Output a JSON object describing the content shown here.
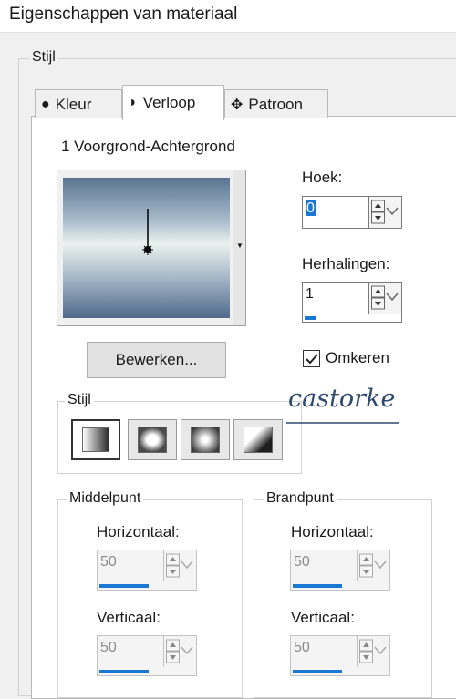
{
  "window": {
    "title": "Eigenschappen van materiaal"
  },
  "style_group": {
    "label": "Stijl"
  },
  "tabs": [
    {
      "label": "Kleur",
      "icon": "filled-circle-icon"
    },
    {
      "label": "Verloop",
      "icon": "half-circle-icon",
      "active": true
    },
    {
      "label": "Patroon",
      "icon": "pattern-icon"
    }
  ],
  "gradient": {
    "name": "1 Voorgrond-Achtergrond",
    "edit_button": "Bewerken...",
    "colors": [
      "#5a7491",
      "#a7bbca",
      "#eaf2ee",
      "#a3b5c6",
      "#50698a"
    ]
  },
  "angle": {
    "label": "Hoek:",
    "value": "0"
  },
  "repeats": {
    "label": "Herhalingen:",
    "value": "1"
  },
  "invert": {
    "label": "Omkeren",
    "checked": true
  },
  "style_sub": {
    "label": "Stijl",
    "options": [
      "linear",
      "rectangular",
      "radial",
      "corner"
    ],
    "selected": 0
  },
  "watermark": {
    "text": "castorke"
  },
  "center_point": {
    "label": "Middelpunt",
    "horizontal_label": "Horizontaal:",
    "horizontal_value": "50",
    "vertical_label": "Verticaal:",
    "vertical_value": "50"
  },
  "focal_point": {
    "label": "Brandpunt",
    "horizontal_label": "Horizontaal:",
    "horizontal_value": "50",
    "vertical_label": "Verticaal:",
    "vertical_value": "50"
  },
  "accent_color": "#1a78d4"
}
